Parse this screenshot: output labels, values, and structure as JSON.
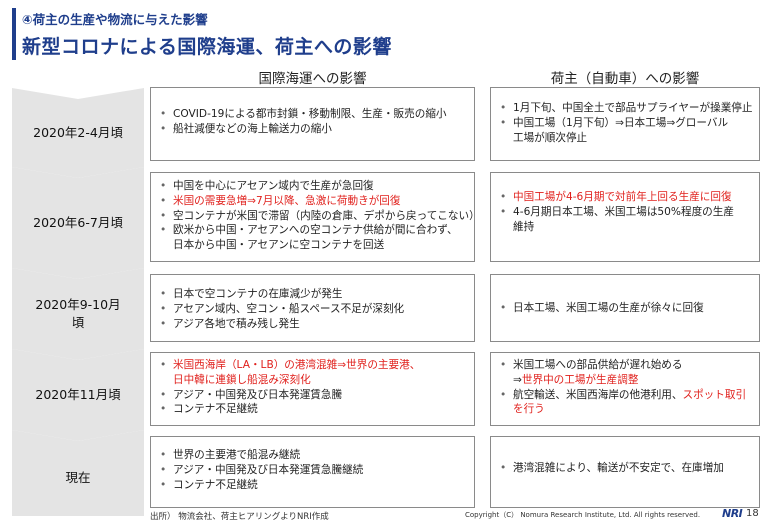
{
  "header": {
    "subtitle": "④荷主の生産や物流に与えた影響",
    "title": "新型コロナによる国際海運、荷主への影響"
  },
  "columns": {
    "left": "国際海運への影響",
    "right": "荷主（自動車）への影響"
  },
  "rows": [
    {
      "period": "2020年2-4月頃",
      "shipping": [
        "COVID-19による都市封鎖・移動制限、生産・販売の縮小",
        "船社減便などの海上輸送力の縮小"
      ],
      "shipper": {
        "item1": "1月下旬、中国全土で部品サプライヤーが操業停止",
        "item2a": "中国工場（1月下旬）⇒日本工場⇒グローバル",
        "item2b": "工場が順次停止"
      }
    },
    {
      "period": "2020年6-7月頃",
      "shipping": {
        "item1": "中国を中心にアセアン域内で生産が急回復",
        "item2": "米国の需要急増⇒7月以降、急激に荷動きが回復",
        "item3": "空コンテナが米国で滞留（内陸の倉庫、デポから戻ってこない）",
        "item4a": "欧米から中国・アセアンへの空コンテナ供給が間に合わず、",
        "item4b": "日本から中国・アセアンに空コンテナを回送"
      },
      "shipper": {
        "item1": "中国工場が4-6月期で対前年上回る生産に回復",
        "item2a": "4-6月期日本工場、米国工場は50%程度の生産",
        "item2b": "維持"
      }
    },
    {
      "period_line1": "2020年9-10月",
      "period_line2": "頃",
      "shipping": [
        "日本で空コンテナの在庫減少が発生",
        "アセアン域内、空コン・船スペース不足が深刻化",
        "アジア各地で積み残し発生"
      ],
      "shipper": [
        "日本工場、米国工場の生産が徐々に回復"
      ]
    },
    {
      "period": "2020年11月頃",
      "shipping": {
        "item1a": "米国西海岸（LA・LB）の港湾混雑⇒世界の主要港、",
        "item1b": "日中韓に連鎖し船混み深刻化",
        "item2": "アジア・中国発及び日本発運賃急騰",
        "item3": "コンテナ不足継続"
      },
      "shipper": {
        "item1a": "米国工場への部品供給が遅れ始める",
        "item1b_plain": "⇒",
        "item1b_red": "世界中の工場が生産調整",
        "item2a_plain": "航空輸送、米国西海岸の他港利用、",
        "item2a_red": "スポット取引",
        "item2b_red": "を行う"
      }
    },
    {
      "period": "現在",
      "shipping": [
        "世界の主要港で船混み継続",
        "アジア・中国発及び日本発運賃急騰継続",
        "コンテナ不足継続"
      ],
      "shipper": [
        "港湾混雑により、輸送が不安定で、在庫増加"
      ]
    }
  ],
  "footer": {
    "source": "出所） 物流会社、荷主ヒアリングよりNRI作成",
    "copyright": "Copyright（C） Nomura Research Institute, Ltd. All rights reserved.",
    "logo": "NRI",
    "page": "18"
  },
  "colors": {
    "accent": "#1f3e8c",
    "highlight_red": "#e0201c",
    "arrow_gray": "#e4e4e4"
  }
}
